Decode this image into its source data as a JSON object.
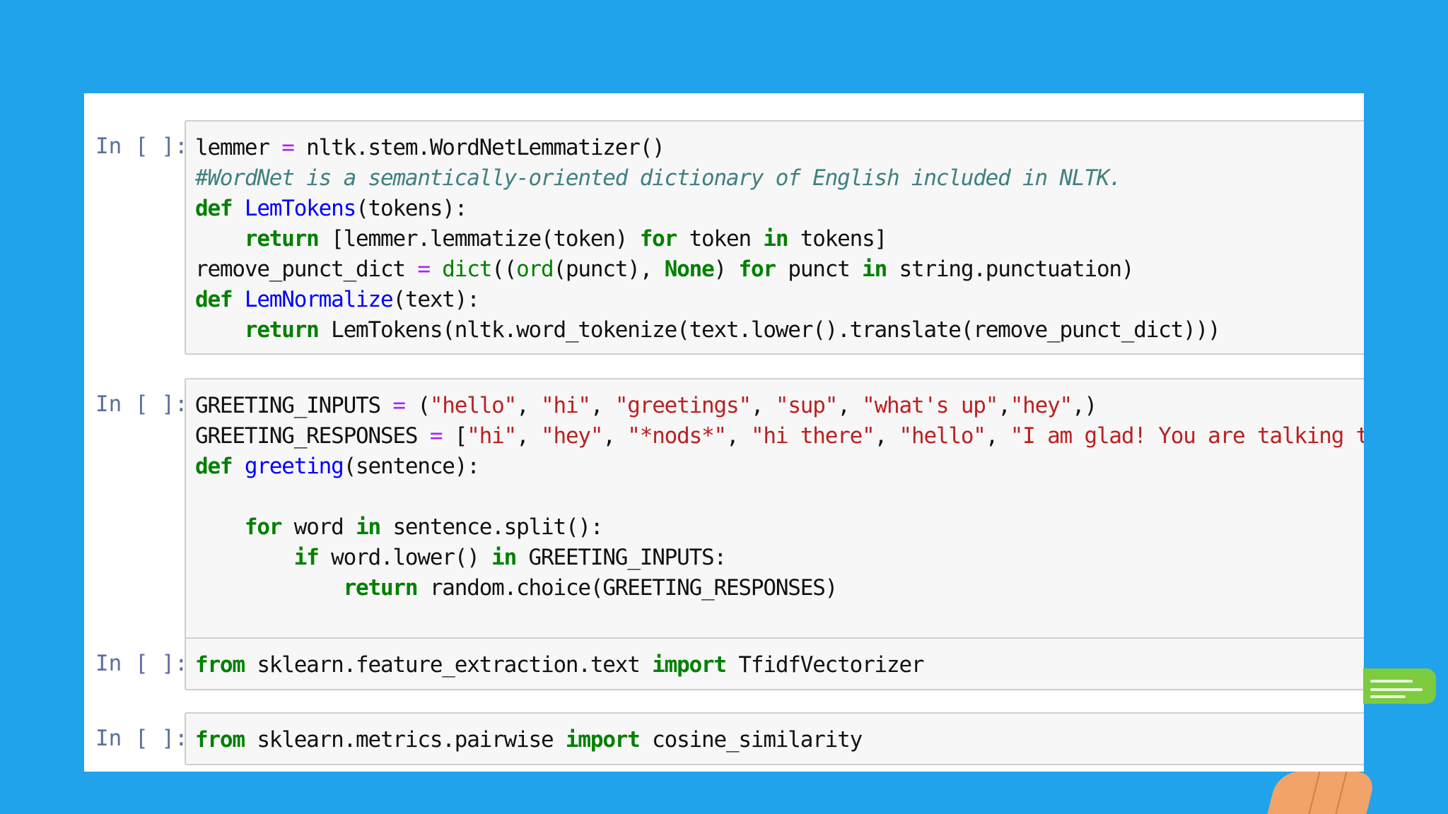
{
  "cells": [
    {
      "prompt": "In [ ]:",
      "lines": [
        [
          {
            "t": "plain",
            "v": "lemmer "
          },
          {
            "t": "op",
            "v": "="
          },
          {
            "t": "plain",
            "v": " nltk.stem.WordNetLemmatizer()"
          }
        ],
        [
          {
            "t": "cm",
            "v": "#WordNet is a semantically-oriented dictionary of English included in NLTK."
          }
        ],
        [
          {
            "t": "kw",
            "v": "def"
          },
          {
            "t": "plain",
            "v": " "
          },
          {
            "t": "fn",
            "v": "LemTokens"
          },
          {
            "t": "plain",
            "v": "(tokens):"
          }
        ],
        [
          {
            "t": "plain",
            "v": "    "
          },
          {
            "t": "kw",
            "v": "return"
          },
          {
            "t": "plain",
            "v": " [lemmer.lemmatize(token) "
          },
          {
            "t": "kw",
            "v": "for"
          },
          {
            "t": "plain",
            "v": " token "
          },
          {
            "t": "kw",
            "v": "in"
          },
          {
            "t": "plain",
            "v": " tokens]"
          }
        ],
        [
          {
            "t": "plain",
            "v": "remove_punct_dict "
          },
          {
            "t": "op",
            "v": "="
          },
          {
            "t": "plain",
            "v": " "
          },
          {
            "t": "bi",
            "v": "dict"
          },
          {
            "t": "plain",
            "v": "(("
          },
          {
            "t": "bi",
            "v": "ord"
          },
          {
            "t": "plain",
            "v": "(punct), "
          },
          {
            "t": "kw",
            "v": "None"
          },
          {
            "t": "plain",
            "v": ") "
          },
          {
            "t": "kw",
            "v": "for"
          },
          {
            "t": "plain",
            "v": " punct "
          },
          {
            "t": "kw",
            "v": "in"
          },
          {
            "t": "plain",
            "v": " string.punctuation)"
          }
        ],
        [
          {
            "t": "kw",
            "v": "def"
          },
          {
            "t": "plain",
            "v": " "
          },
          {
            "t": "fn",
            "v": "LemNormalize"
          },
          {
            "t": "plain",
            "v": "(text):"
          }
        ],
        [
          {
            "t": "plain",
            "v": "    "
          },
          {
            "t": "kw",
            "v": "return"
          },
          {
            "t": "plain",
            "v": " LemTokens(nltk.word_tokenize(text.lower().translate(remove_punct_dict)))"
          }
        ]
      ]
    },
    {
      "prompt": "In [ ]:",
      "lines": [
        [
          {
            "t": "plain",
            "v": "GREETING_INPUTS "
          },
          {
            "t": "op",
            "v": "="
          },
          {
            "t": "plain",
            "v": " ("
          },
          {
            "t": "str",
            "v": "\"hello\""
          },
          {
            "t": "plain",
            "v": ", "
          },
          {
            "t": "str",
            "v": "\"hi\""
          },
          {
            "t": "plain",
            "v": ", "
          },
          {
            "t": "str",
            "v": "\"greetings\""
          },
          {
            "t": "plain",
            "v": ", "
          },
          {
            "t": "str",
            "v": "\"sup\""
          },
          {
            "t": "plain",
            "v": ", "
          },
          {
            "t": "str",
            "v": "\"what's up\""
          },
          {
            "t": "plain",
            "v": ","
          },
          {
            "t": "str",
            "v": "\"hey\""
          },
          {
            "t": "plain",
            "v": ",)"
          }
        ],
        [
          {
            "t": "plain",
            "v": "GREETING_RESPONSES "
          },
          {
            "t": "op",
            "v": "="
          },
          {
            "t": "plain",
            "v": " ["
          },
          {
            "t": "str",
            "v": "\"hi\""
          },
          {
            "t": "plain",
            "v": ", "
          },
          {
            "t": "str",
            "v": "\"hey\""
          },
          {
            "t": "plain",
            "v": ", "
          },
          {
            "t": "str",
            "v": "\"*nods*\""
          },
          {
            "t": "plain",
            "v": ", "
          },
          {
            "t": "str",
            "v": "\"hi there\""
          },
          {
            "t": "plain",
            "v": ", "
          },
          {
            "t": "str",
            "v": "\"hello\""
          },
          {
            "t": "plain",
            "v": ", "
          },
          {
            "t": "str",
            "v": "\"I am glad! You are talking to me\""
          },
          {
            "t": "plain",
            "v": "]"
          }
        ],
        [
          {
            "t": "kw",
            "v": "def"
          },
          {
            "t": "plain",
            "v": " "
          },
          {
            "t": "fn",
            "v": "greeting"
          },
          {
            "t": "plain",
            "v": "(sentence):"
          }
        ],
        [],
        [
          {
            "t": "plain",
            "v": "    "
          },
          {
            "t": "kw",
            "v": "for"
          },
          {
            "t": "plain",
            "v": " word "
          },
          {
            "t": "kw",
            "v": "in"
          },
          {
            "t": "plain",
            "v": " sentence.split():"
          }
        ],
        [
          {
            "t": "plain",
            "v": "        "
          },
          {
            "t": "kw",
            "v": "if"
          },
          {
            "t": "plain",
            "v": " word.lower() "
          },
          {
            "t": "kw",
            "v": "in"
          },
          {
            "t": "plain",
            "v": " GREETING_INPUTS:"
          }
        ],
        [
          {
            "t": "plain",
            "v": "            "
          },
          {
            "t": "kw",
            "v": "return"
          },
          {
            "t": "plain",
            "v": " random.choice(GREETING_RESPONSES)"
          }
        ]
      ]
    },
    {
      "prompt": "In [ ]:",
      "lines": [
        [
          {
            "t": "kw",
            "v": "from"
          },
          {
            "t": "plain",
            "v": " sklearn.feature_extraction.text "
          },
          {
            "t": "kw",
            "v": "import"
          },
          {
            "t": "plain",
            "v": " TfidfVectorizer"
          }
        ]
      ]
    },
    {
      "prompt": "In [ ]:",
      "lines": [
        [
          {
            "t": "kw",
            "v": "from"
          },
          {
            "t": "plain",
            "v": " sklearn.metrics.pairwise "
          },
          {
            "t": "kw",
            "v": "import"
          },
          {
            "t": "plain",
            "v": " cosine_similarity"
          }
        ]
      ]
    }
  ],
  "colors": {
    "background": "#20a3ea",
    "keyword": "#008000",
    "function_name": "#0000ff",
    "string": "#ba2121",
    "operator": "#aa22ff",
    "comment": "#408080",
    "prompt": "#5a6f9f"
  }
}
